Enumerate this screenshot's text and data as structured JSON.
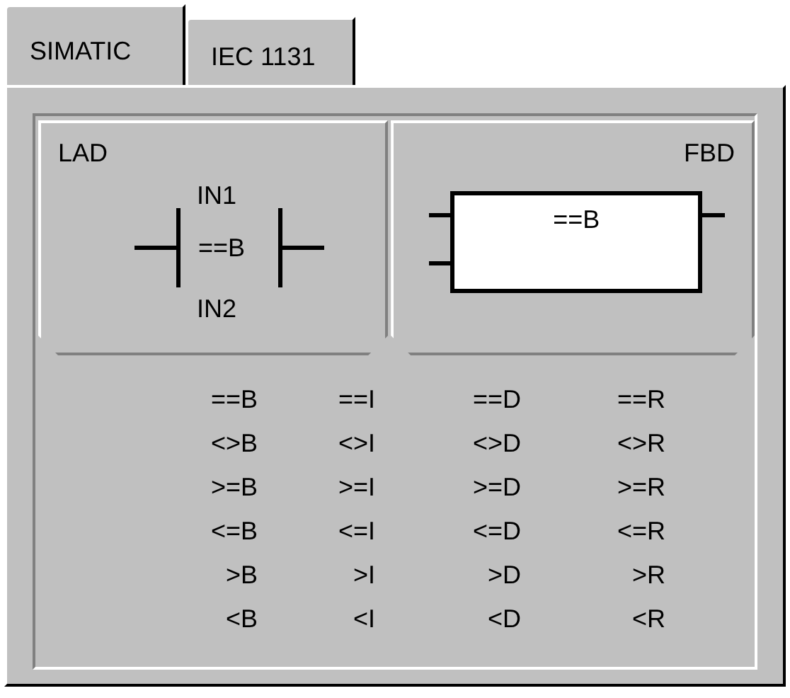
{
  "tabs": [
    {
      "label": "SIMATIC",
      "selected": true
    },
    {
      "label": "IEC 1131",
      "selected": false
    }
  ],
  "views": [
    {
      "kind": "lad",
      "label": "LAD",
      "top": "IN1",
      "op": "==B",
      "bottom": "IN2"
    },
    {
      "kind": "fbd",
      "label": "FBD",
      "op": "==B"
    }
  ],
  "operators": [
    [
      "==B",
      "<>B",
      ">=B",
      "<=B",
      ">B",
      "<B"
    ],
    [
      "==I",
      "<>I",
      ">=I",
      "<=I",
      ">I",
      "<I"
    ],
    [
      "==D",
      "<>D",
      ">=D",
      "<=D",
      ">D",
      "<D"
    ],
    [
      "==R",
      "<>R",
      ">=R",
      "<=R",
      ">R",
      "<R"
    ]
  ]
}
